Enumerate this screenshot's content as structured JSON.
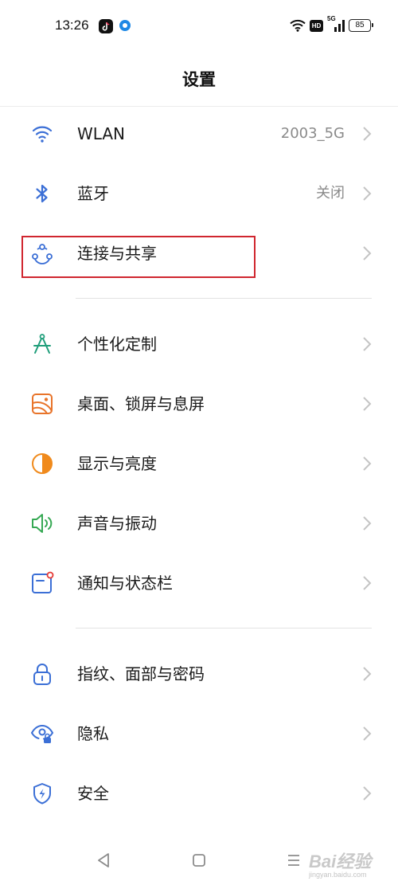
{
  "status_bar": {
    "time": "13:26",
    "network_type": "5G",
    "hd_badge": "HD",
    "battery_level": "85",
    "icons": [
      "tiktok-icon",
      "app-notification-icon",
      "wifi-icon",
      "hd-icon",
      "signal-icon",
      "battery-icon"
    ]
  },
  "header": {
    "title": "设置"
  },
  "sections": [
    {
      "items": [
        {
          "label": "WLAN",
          "value": "2003_5G",
          "icon": "wifi-icon",
          "color": "#3b6fd6"
        },
        {
          "label": "蓝牙",
          "value": "关闭",
          "icon": "bluetooth-icon",
          "color": "#3b6fd6"
        },
        {
          "label": "连接与共享",
          "value": "",
          "icon": "share-network-icon",
          "color": "#3b6fd6",
          "highlighted": true
        }
      ]
    },
    {
      "items": [
        {
          "label": "个性化定制",
          "value": "",
          "icon": "compass-drawing-icon",
          "color": "#1f9e7a"
        },
        {
          "label": "桌面、锁屏与息屏",
          "value": "",
          "icon": "wallpaper-icon",
          "color": "#e8742a"
        },
        {
          "label": "显示与亮度",
          "value": "",
          "icon": "brightness-icon",
          "color": "#f08a1c"
        },
        {
          "label": "声音与振动",
          "value": "",
          "icon": "speaker-icon",
          "color": "#35a853"
        },
        {
          "label": "通知与状态栏",
          "value": "",
          "icon": "notification-icon",
          "color": "#3b6fd6"
        }
      ]
    },
    {
      "items": [
        {
          "label": "指纹、面部与密码",
          "value": "",
          "icon": "lock-icon",
          "color": "#3b6fd6"
        },
        {
          "label": "隐私",
          "value": "",
          "icon": "privacy-eye-icon",
          "color": "#3b6fd6"
        },
        {
          "label": "安全",
          "value": "",
          "icon": "security-shield-icon",
          "color": "#3b6fd6"
        }
      ]
    }
  ],
  "annotation": {
    "highlight_color": "#d0262f"
  },
  "nav_bar": {
    "icons": [
      "back-icon",
      "home-icon",
      "menu-icon"
    ]
  },
  "watermark": {
    "text": "Bai经验",
    "subtext": "jingyan.baidu.com"
  }
}
